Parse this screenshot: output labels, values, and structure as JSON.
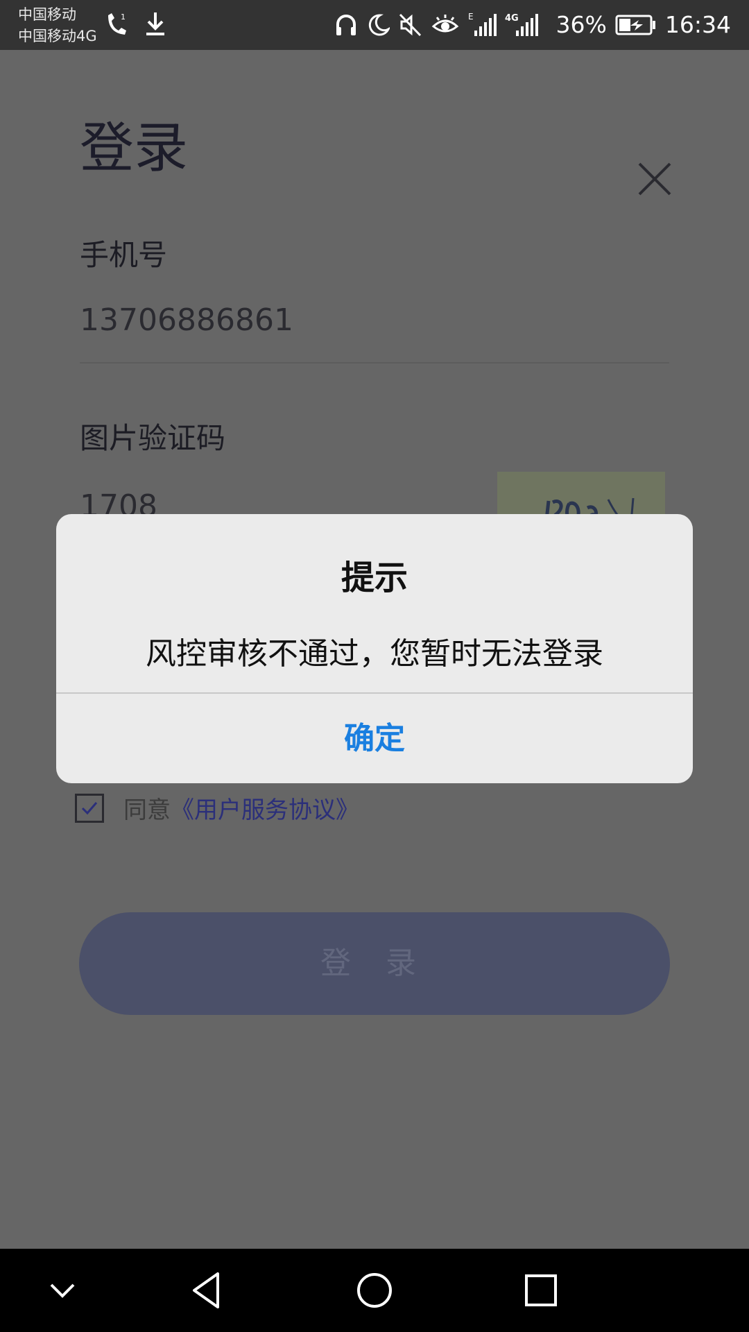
{
  "status_bar": {
    "carrier_1": "中国移动",
    "carrier_2": "中国移动4G",
    "network_label": "4G",
    "network_small_label": "E",
    "battery_percent": "36%",
    "time": "16:34"
  },
  "login": {
    "title": "登录",
    "phone_label": "手机号",
    "phone_value": "13706886861",
    "captcha_label": "图片验证码",
    "captcha_value": "1708",
    "agree_prefix": "同意",
    "agree_link": "《用户服务协议》",
    "agree_checked": true,
    "login_button": "登 录"
  },
  "dialog": {
    "title": "提示",
    "message": "风控审核不通过，您暂时无法登录",
    "confirm": "确定"
  },
  "colors": {
    "dialog_button": "#1a7fe0",
    "overlay": "#666666",
    "login_button": "#4b5069"
  },
  "icons": [
    "wifi-call-icon",
    "download-icon",
    "headset-icon",
    "moon-icon",
    "mute-icon",
    "eye-icon",
    "signal-icon",
    "battery-icon",
    "close-icon",
    "checkbox-check-icon",
    "nav-collapse-icon",
    "nav-back-icon",
    "nav-home-icon",
    "nav-recents-icon"
  ]
}
